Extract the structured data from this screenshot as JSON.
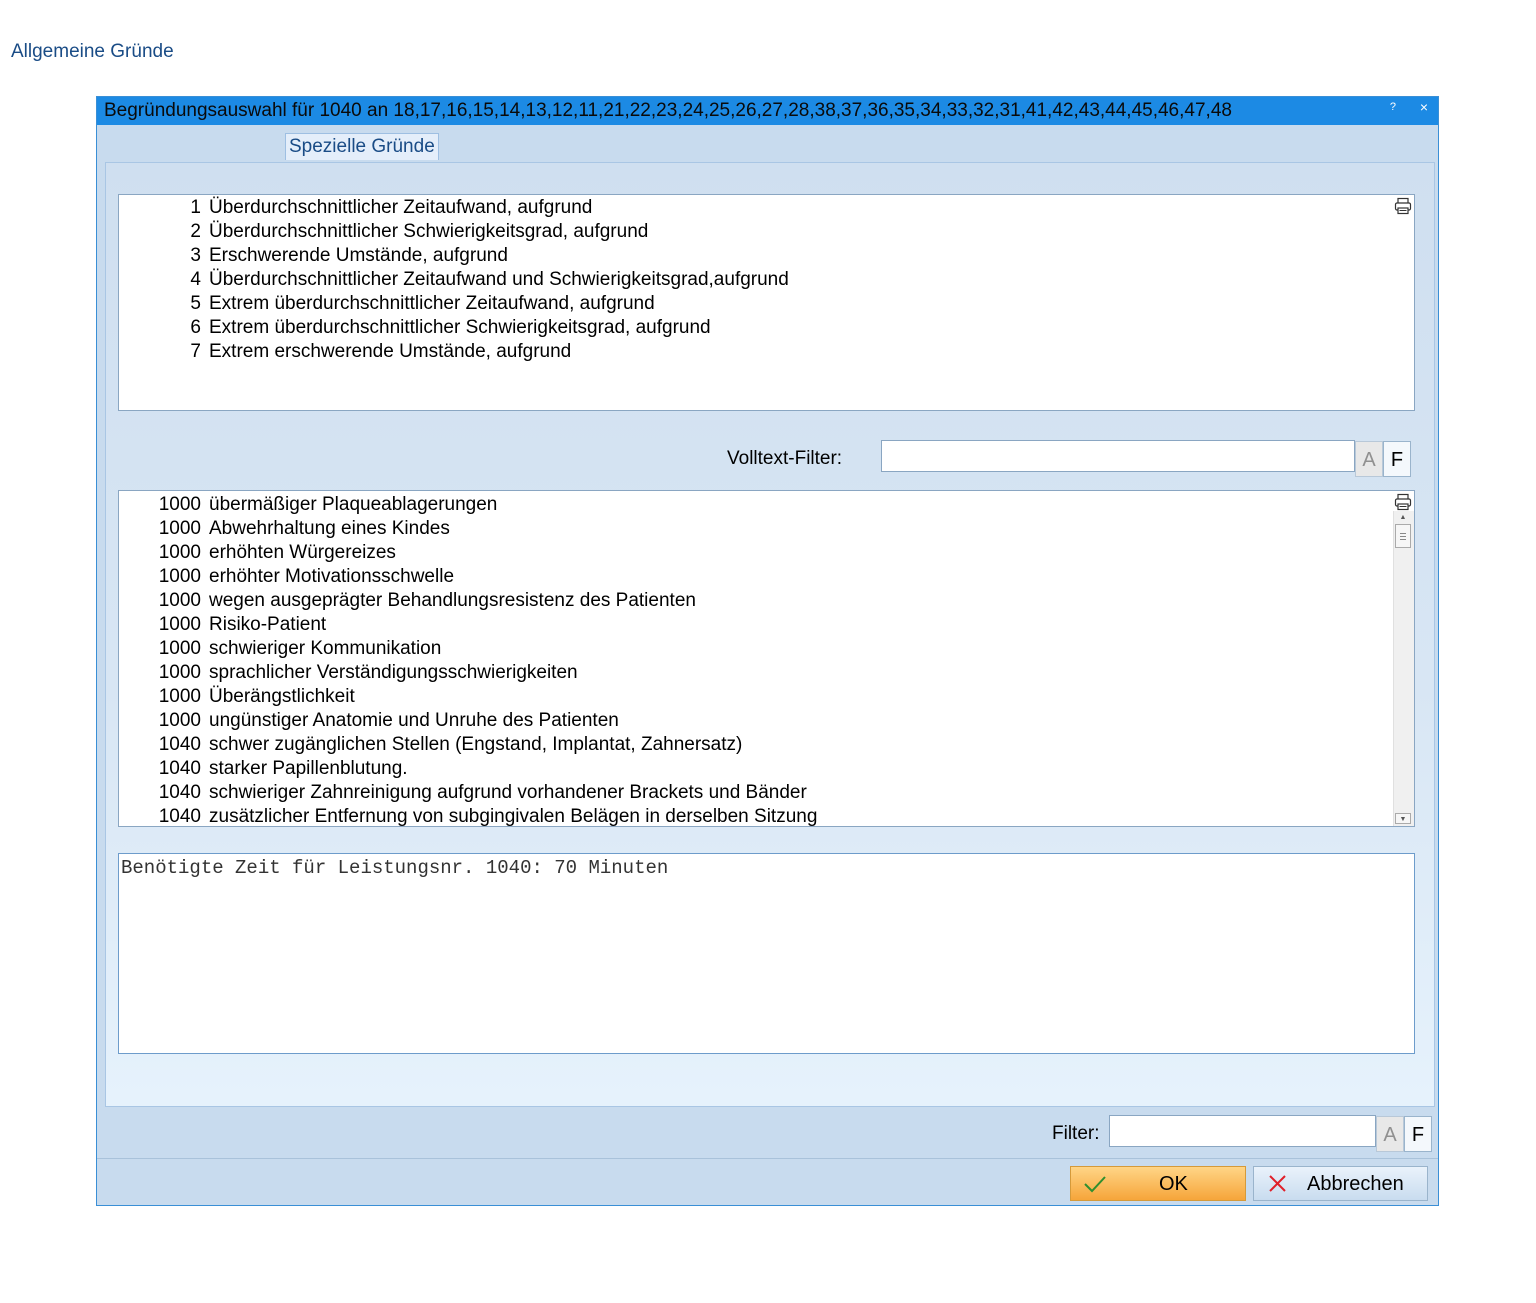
{
  "window": {
    "title": "Begründungsauswahl für 1040 an 18,17,16,15,14,13,12,11,21,22,23,24,25,26,27,28,38,37,36,35,34,33,32,31,41,42,43,44,45,46,47,48",
    "help_label": "?",
    "close_label": "×"
  },
  "tabs": [
    {
      "label": "Allgemeine Gründe",
      "active": false
    },
    {
      "label": "Spezielle Gründe",
      "active": true
    }
  ],
  "reasons_list": [
    {
      "num": "1",
      "text": "Überdurchschnittlicher Zeitaufwand, aufgrund"
    },
    {
      "num": "2",
      "text": "Überdurchschnittlicher Schwierigkeitsgrad, aufgrund"
    },
    {
      "num": "3",
      "text": "Erschwerende Umstände, aufgrund"
    },
    {
      "num": "4",
      "text": "Überdurchschnittlicher Zeitaufwand und Schwierigkeitsgrad,aufgrund"
    },
    {
      "num": "5",
      "text": "Extrem überdurchschnittlicher Zeitaufwand, aufgrund"
    },
    {
      "num": "6",
      "text": "Extrem überdurchschnittlicher Schwierigkeitsgrad, aufgrund"
    },
    {
      "num": "7",
      "text": "Extrem erschwerende Umstände, aufgrund"
    }
  ],
  "fulltext_filter": {
    "label": "Volltext-Filter:",
    "value": "",
    "btn_a": "A",
    "btn_f": "F"
  },
  "details_list": [
    {
      "num": "1000",
      "text": "übermäßiger Plaqueablagerungen"
    },
    {
      "num": "1000",
      "text": "Abwehrhaltung eines Kindes"
    },
    {
      "num": "1000",
      "text": "erhöhten Würgereizes"
    },
    {
      "num": "1000",
      "text": "erhöhter Motivationsschwelle"
    },
    {
      "num": "1000",
      "text": "wegen ausgeprägter Behandlungsresistenz des Patienten"
    },
    {
      "num": "1000",
      "text": "Risiko-Patient"
    },
    {
      "num": "1000",
      "text": "schwieriger Kommunikation"
    },
    {
      "num": "1000",
      "text": "sprachlicher Verständigungsschwierigkeiten"
    },
    {
      "num": "1000",
      "text": "Überängstlichkeit"
    },
    {
      "num": "1000",
      "text": "ungünstiger Anatomie und Unruhe des Patienten"
    },
    {
      "num": "1040",
      "text": "schwer zugänglichen Stellen (Engstand, Implantat, Zahnersatz)"
    },
    {
      "num": "1040",
      "text": "starker Papillenblutung."
    },
    {
      "num": "1040",
      "text": "schwieriger Zahnreinigung aufgrund vorhandener Brackets und Bänder"
    },
    {
      "num": "1040",
      "text": "zusätzlicher Entfernung von subgingivalen Belägen in derselben Sitzung"
    }
  ],
  "memo": {
    "text": "Benötigte Zeit für Leistungsnr. 1040: 70 Minuten"
  },
  "bottom_filter": {
    "label": "Filter:",
    "value": "",
    "btn_a": "A",
    "btn_f": "F"
  },
  "buttons": {
    "ok": "OK",
    "cancel": "Abbrechen"
  },
  "icons": {
    "printer": "printer-icon",
    "ok": "checkmark-icon",
    "cancel": "close-icon"
  }
}
